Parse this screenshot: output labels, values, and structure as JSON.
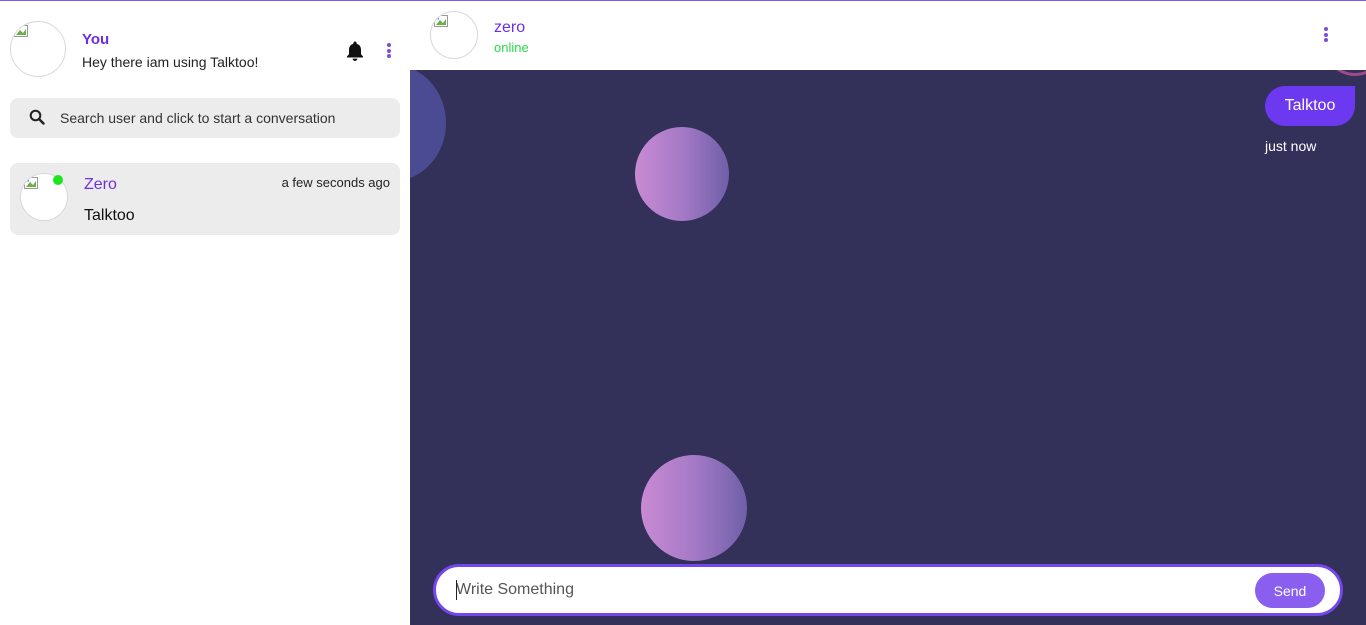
{
  "sidebar": {
    "me": {
      "name": "You",
      "status": "Hey there iam using Talktoo!",
      "avatar_icon": "broken-image-icon"
    },
    "icons": {
      "notifications": "bell-icon",
      "menu": "kebab-menu-icon"
    },
    "search": {
      "placeholder": "Search user and click to start a conversation",
      "icon": "search-icon"
    },
    "conversations": [
      {
        "name": "Zero",
        "time": "a few seconds ago",
        "last_message": "Talktoo",
        "online": true
      }
    ]
  },
  "chat": {
    "peer": {
      "name": "zero",
      "status": "online"
    },
    "messages": [
      {
        "text": "Talktoo",
        "time": "just now",
        "outgoing": true
      }
    ],
    "composer": {
      "placeholder": "Write Something",
      "send_label": "Send"
    }
  },
  "colors": {
    "accent": "#6c2fe6",
    "chat_background": "#33305a",
    "online": "#1fe51f",
    "bubble": "#6c38f0",
    "send_button": "#8a5ff0"
  }
}
